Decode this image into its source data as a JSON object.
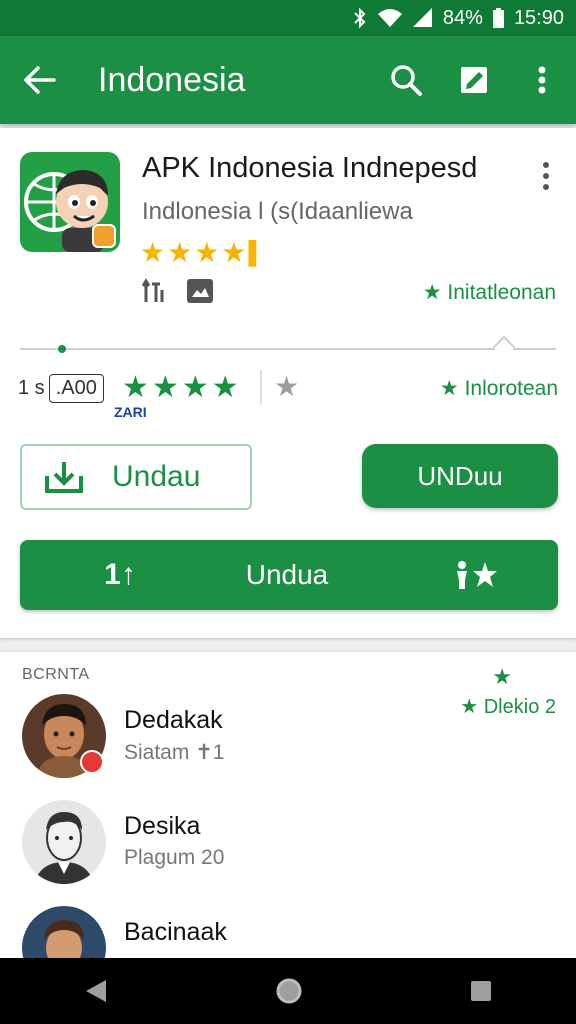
{
  "status_bar": {
    "battery": "84%",
    "time": "15:90"
  },
  "app_bar": {
    "title": "Indonesia",
    "back_icon": "arrow-left-icon",
    "search_icon": "search-icon",
    "edit_icon": "edit-square-icon",
    "more_icon": "more-vert-icon"
  },
  "app": {
    "title": "APK Indonesia Indnepesd",
    "subtitle": "Indlonesia l (s(Idaanliewa",
    "rating_stars": 4.5,
    "installed_label": "★ Initatleonan"
  },
  "stats": {
    "prefix": "1 s",
    "count": ".A00",
    "small_label": "ZARI",
    "right_label": "Inlorotean"
  },
  "buttons": {
    "outline_label": "Undau",
    "solid_label": "UNDuu",
    "wide_left": "1↑",
    "wide_label": "Undua"
  },
  "section": {
    "label": "BCRNTA",
    "right_label": "★ Dlekio 2",
    "people": [
      {
        "name": "Dedakak",
        "meta": "Siatam ✝1"
      },
      {
        "name": "Desika",
        "meta": "Plagum 20"
      },
      {
        "name": "Bacinaak",
        "meta": ""
      }
    ]
  },
  "colors": {
    "brand": "#1b8f44",
    "status_bar": "#0f7a35",
    "star_gold": "#f4b400"
  }
}
